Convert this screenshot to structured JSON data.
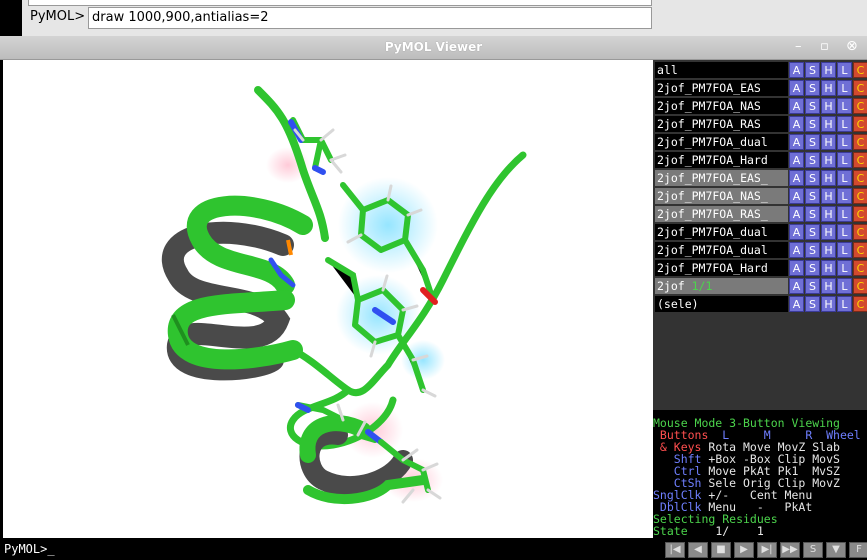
{
  "command_bar": {
    "prompt": "PyMOL>",
    "input_value": "draw 1000,900,antialias=2"
  },
  "window": {
    "title": "PyMOL Viewer",
    "controls": [
      "minimize-icon",
      "restore-icon",
      "close-icon"
    ]
  },
  "objects": [
    {
      "name": "all",
      "state": ""
    },
    {
      "name": "2jof_PM7FOA_EAS",
      "state": ""
    },
    {
      "name": "2jof_PM7FOA_NAS",
      "state": ""
    },
    {
      "name": "2jof_PM7FOA_RAS",
      "state": ""
    },
    {
      "name": "2jof_PM7FOA_dual",
      "state": ""
    },
    {
      "name": "2jof_PM7FOA_Hard",
      "state": ""
    },
    {
      "name": "2jof_PM7FOA_EAS_",
      "state": ""
    },
    {
      "name": "2jof_PM7FOA_NAS_",
      "state": ""
    },
    {
      "name": "2jof_PM7FOA_RAS_",
      "state": ""
    },
    {
      "name": "2jof_PM7FOA_dual",
      "state": ""
    },
    {
      "name": "2jof_PM7FOA_dual",
      "state": ""
    },
    {
      "name": "2jof_PM7FOA_Hard",
      "state": ""
    },
    {
      "name": "2jof",
      "state": "1/1"
    },
    {
      "name": "(sele)",
      "state": ""
    }
  ],
  "object_buttons": [
    "A",
    "S",
    "H",
    "L",
    "C"
  ],
  "mouse_info": {
    "line1": "Mouse Mode 3-Button Viewing",
    "buttons_header": " Buttons  L     M     R  Wheel",
    "keys": [
      " & Keys",
      " Rota",
      " Move",
      " MovZ",
      " Slab"
    ],
    "rows": [
      {
        "mod": "Shft",
        "cols": " +Box -Box Clip MovS"
      },
      {
        "mod": "Ctrl",
        "cols": " Move PkAt Pk1  MvSZ"
      },
      {
        "mod": "CtSh",
        "cols": " Sele Orig Clip MovZ"
      }
    ],
    "sngl": {
      "mod": "SnglClk",
      "cols": " +/-   Cent Menu"
    },
    "dbl": {
      "mod": "DblClk",
      "cols": " Menu   -   PkAt"
    },
    "selecting": "Selecting Residues",
    "state_label": "State",
    "state_value": "    1/    1"
  },
  "movie_controls": [
    "|◀",
    "◀",
    "■",
    "▶",
    "▶|",
    "▶▶",
    "S",
    "▼",
    "F"
  ],
  "bottom_prompt": "PyMOL>_"
}
